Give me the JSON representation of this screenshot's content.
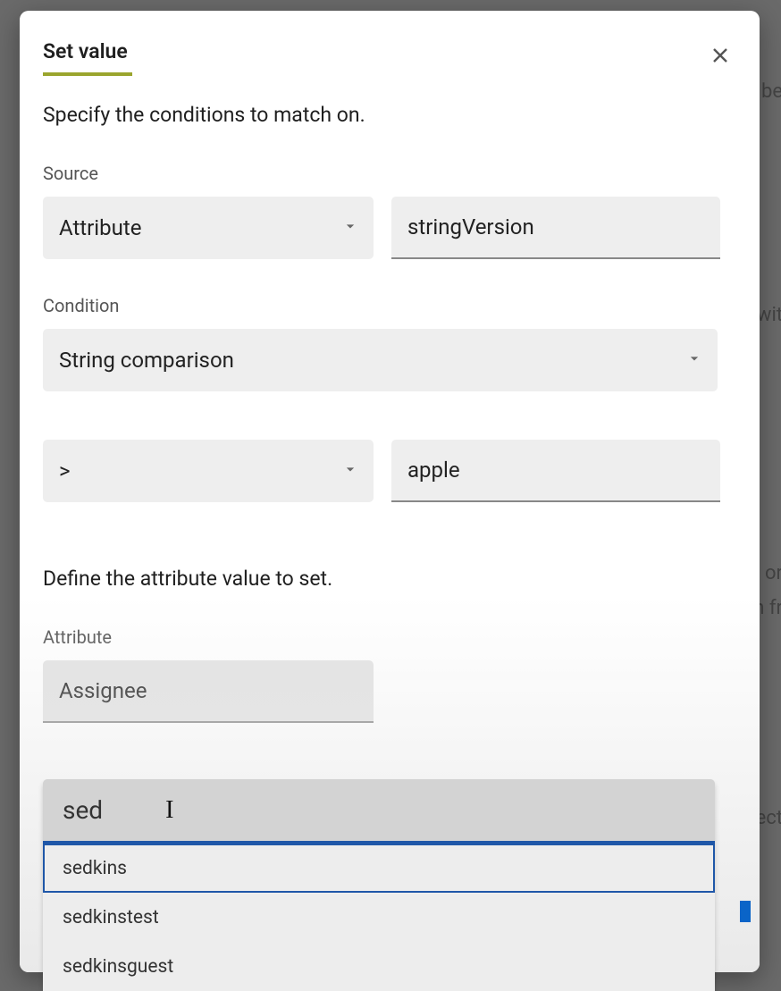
{
  "backdrop": {
    "t1": "be",
    "t2": "wit",
    "t3": "or",
    "t4": "n fr",
    "t5": "ect"
  },
  "dialog": {
    "title": "Set value",
    "subtitle1": "Specify the conditions to match on.",
    "source_label": "Source",
    "source_type": "Attribute",
    "source_value": "stringVersion",
    "condition_label": "Condition",
    "condition_type": "String comparison",
    "operator": ">",
    "compare_value": "apple",
    "subtitle2": "Define the attribute value to set.",
    "attribute_label": "Attribute",
    "attribute_value": "Assignee"
  },
  "autocomplete": {
    "query": "sed",
    "options": [
      "sedkins",
      "sedkinstest",
      "sedkinsguest"
    ],
    "highlighted": 0
  }
}
